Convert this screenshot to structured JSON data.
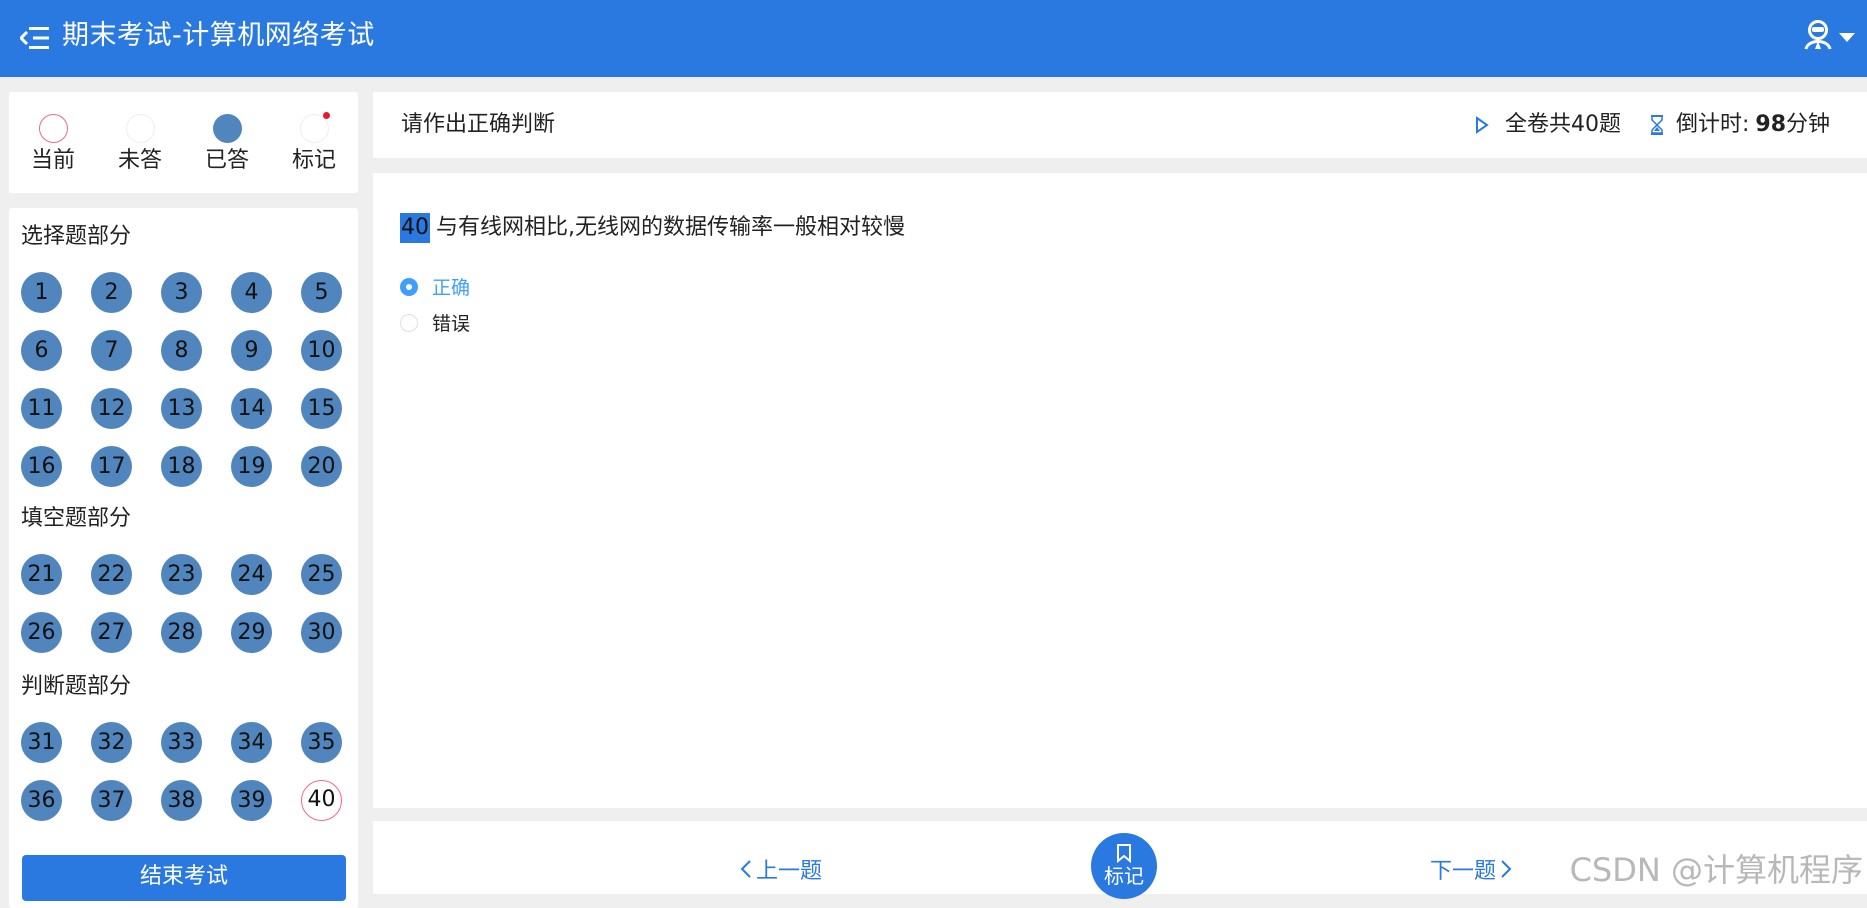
{
  "header": {
    "title": "期末考试-计算机网络考试",
    "menu_icon": "menu-fold-icon",
    "user_icon": "user-avatar-icon"
  },
  "legend": [
    {
      "label": "当前",
      "state": "current"
    },
    {
      "label": "未答",
      "state": "unanswered"
    },
    {
      "label": "已答",
      "state": "answered"
    },
    {
      "label": "标记",
      "state": "marked"
    }
  ],
  "sections": [
    {
      "title": "选择题部分",
      "questions": [
        1,
        2,
        3,
        4,
        5,
        6,
        7,
        8,
        9,
        10,
        11,
        12,
        13,
        14,
        15,
        16,
        17,
        18,
        19,
        20
      ]
    },
    {
      "title": "填空题部分",
      "questions": [
        21,
        22,
        23,
        24,
        25,
        26,
        27,
        28,
        29,
        30
      ]
    },
    {
      "title": "判断题部分",
      "questions": [
        31,
        32,
        33,
        34,
        35,
        36,
        37,
        38,
        39,
        40
      ]
    }
  ],
  "current_question": 40,
  "finish_label": "结束考试",
  "info": {
    "instruction": "请作出正确判断",
    "total_label": "全卷共40题",
    "timer_prefix": "倒计时:",
    "timer_value": "98",
    "timer_unit": "分钟"
  },
  "question": {
    "number": "40",
    "text": "与有线网相比,无线网的数据传输率一般相对较慢",
    "options": [
      {
        "label": "正确",
        "selected": true
      },
      {
        "label": "错误",
        "selected": false
      }
    ]
  },
  "nav": {
    "prev_label": "上一题",
    "mark_label": "标记",
    "next_label": "下一题"
  },
  "watermark": "CSDN @计算机程序",
  "colors": {
    "primary": "#2979e0",
    "answered": "#5086bd",
    "current_border": "#f06b8a",
    "marked_dot": "#e8192c",
    "selected_option": "#409eff"
  }
}
